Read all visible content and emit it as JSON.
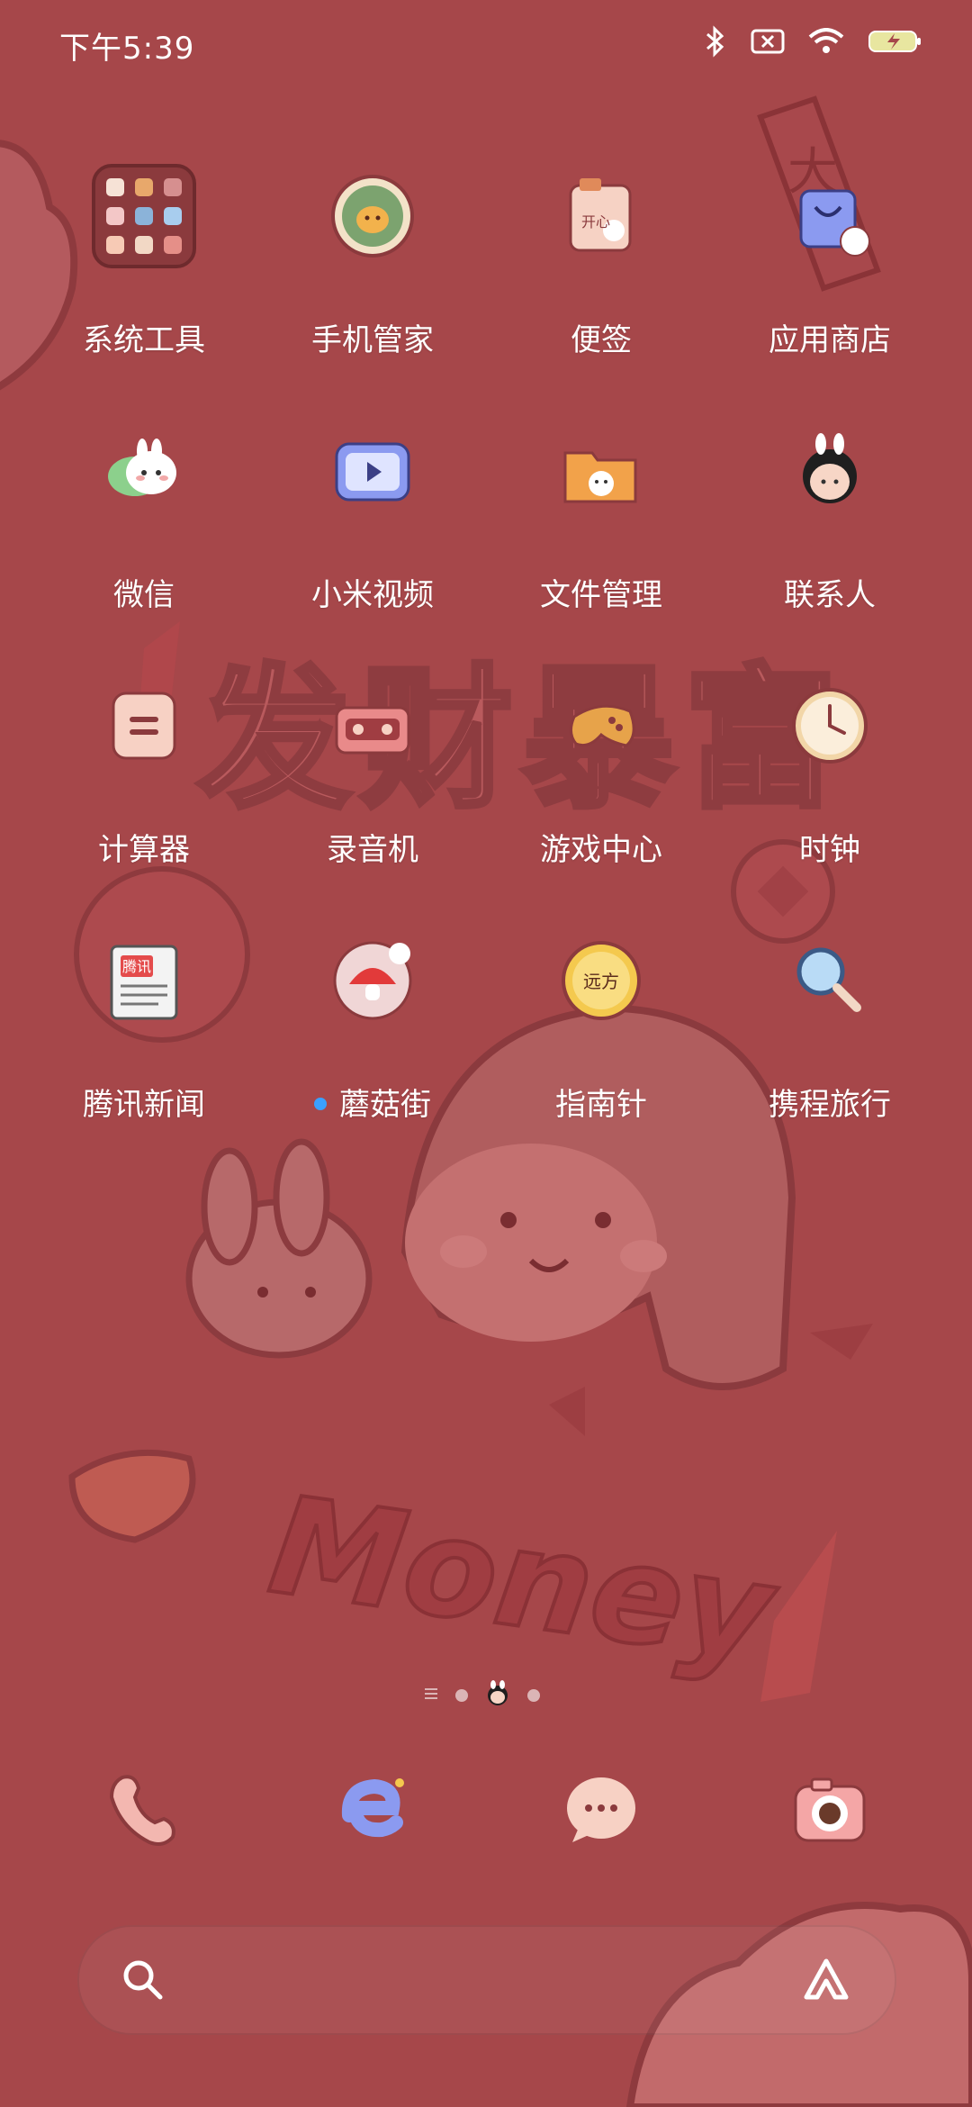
{
  "status_bar": {
    "time": "下午5:39",
    "icons": [
      "bluetooth-icon",
      "sim-off-icon",
      "wifi-icon",
      "battery-charging-icon"
    ]
  },
  "wallpaper": {
    "headline": "发财暴富",
    "word": "Money"
  },
  "home": {
    "rows": [
      [
        {
          "label": "系统工具",
          "icon": "folder-icon"
        },
        {
          "label": "手机管家",
          "icon": "cat-shield-icon"
        },
        {
          "label": "便签",
          "icon": "notes-icon"
        },
        {
          "label": "应用商店",
          "icon": "shopping-bag-icon"
        }
      ],
      [
        {
          "label": "微信",
          "icon": "wechat-icon"
        },
        {
          "label": "小米视频",
          "icon": "video-icon"
        },
        {
          "label": "文件管理",
          "icon": "folder-cat-icon"
        },
        {
          "label": "联系人",
          "icon": "contacts-girl-icon"
        }
      ],
      [
        {
          "label": "计算器",
          "icon": "calculator-icon"
        },
        {
          "label": "录音机",
          "icon": "recorder-icon"
        },
        {
          "label": "游戏中心",
          "icon": "gamepad-icon"
        },
        {
          "label": "时钟",
          "icon": "clock-icon"
        }
      ],
      [
        {
          "label": "腾讯新闻",
          "icon": "news-icon",
          "stamp": "腾讯"
        },
        {
          "label": "蘑菇街",
          "icon": "mushroom-icon",
          "badge": true
        },
        {
          "label": "指南针",
          "icon": "compass-icon",
          "stamp": "远方"
        },
        {
          "label": "携程旅行",
          "icon": "magnifier-icon"
        }
      ]
    ]
  },
  "pager": {
    "pages": 3,
    "active": 2
  },
  "dock": [
    {
      "label": "电话",
      "icon": "phone-icon"
    },
    {
      "label": "浏览器",
      "icon": "browser-icon"
    },
    {
      "label": "短信",
      "icon": "message-icon"
    },
    {
      "label": "相机",
      "icon": "camera-icon"
    }
  ],
  "search": {
    "placeholder": ""
  },
  "colors": {
    "background": "#a6474a",
    "label": "#ffffff",
    "badge": "#3aa0ff"
  }
}
